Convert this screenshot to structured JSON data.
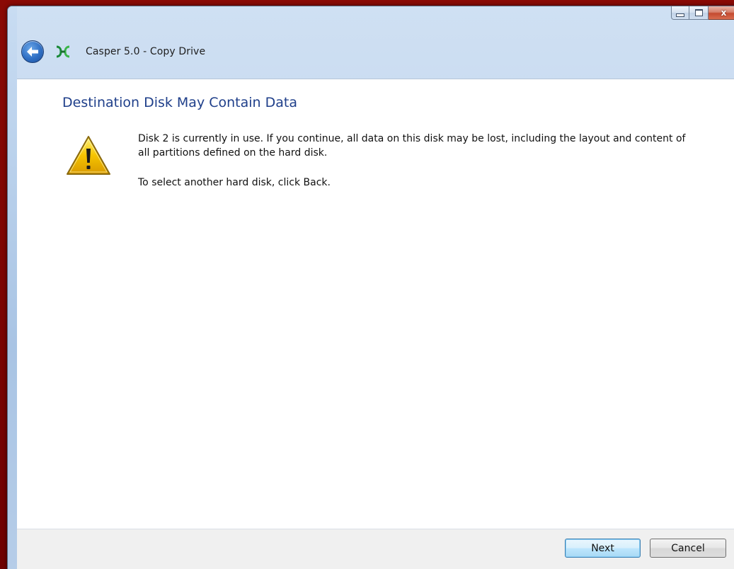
{
  "window": {
    "title": "Casper 5.0 - Copy Drive",
    "caption_buttons": {
      "minimize_icon": "minimize-icon",
      "maximize_icon": "maximize-icon",
      "close_glyph": "x"
    }
  },
  "navigation": {
    "back_icon": "back-arrow-icon",
    "app_icon": "casper-app-icon"
  },
  "content": {
    "heading": "Destination Disk May Contain Data",
    "warning_icon": "warning-icon",
    "message": "Disk 2 is currently in use. If you continue, all data on this disk may be lost, including the layout and content of all partitions defined on the hard disk.",
    "message_secondary": "To select another hard disk, click Back."
  },
  "footer": {
    "next_label": "Next",
    "cancel_label": "Cancel"
  },
  "colors": {
    "heading": "#1f3f8a",
    "background": "#7a0000",
    "warning_fill": "#f5c400"
  }
}
